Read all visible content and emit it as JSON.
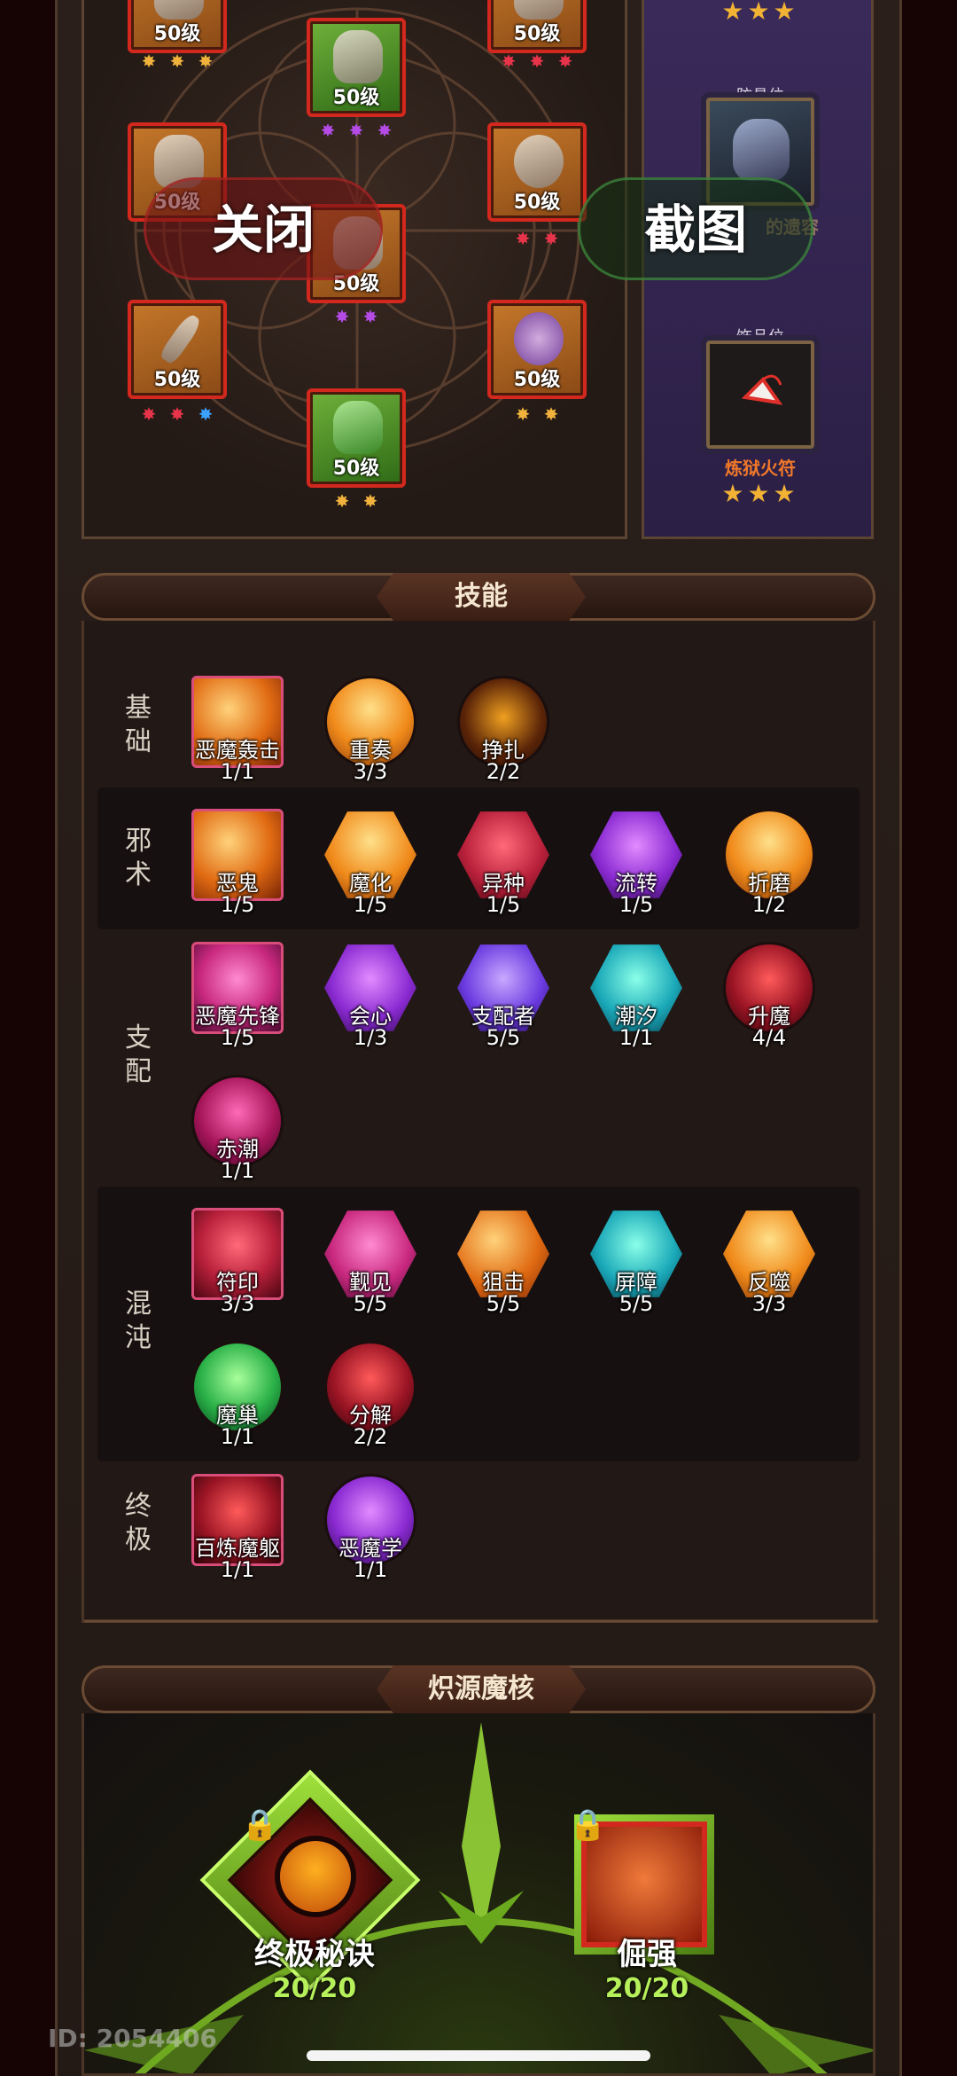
{
  "equipment": {
    "items": [
      {
        "level": "50级",
        "gems": [
          "gold",
          "gold",
          "gold"
        ]
      },
      {
        "level": "50级",
        "gems": [
          "red",
          "red",
          "red"
        ]
      },
      {
        "level": "50级",
        "gems": [
          "purple",
          "purple",
          "purple"
        ]
      },
      {
        "level": "50级",
        "gems": [
          "red",
          "red"
        ]
      },
      {
        "level": "50级",
        "gems": [
          "red",
          "red"
        ]
      },
      {
        "level": "50级",
        "gems": [
          "purple",
          "purple"
        ]
      },
      {
        "level": "50级",
        "gems": [
          "red",
          "red",
          "blue"
        ]
      },
      {
        "level": "50级",
        "gems": [
          "gold",
          "gold"
        ]
      },
      {
        "level": "50级",
        "gems": [
          "gold",
          "gold"
        ]
      }
    ],
    "slots": {
      "armor_label": "防具位",
      "armor_name": "的遗容",
      "accessory_label": "饰品位",
      "accessory_name": "炼狱火符"
    }
  },
  "overlay": {
    "close_label": "关闭",
    "screenshot_label": "截图"
  },
  "skills": {
    "title": "技能",
    "categories": [
      {
        "label": "基础",
        "skills": [
          {
            "name": "恶魔轰击",
            "count": "1/1",
            "shape": "sq",
            "color": "c-orange"
          },
          {
            "name": "重奏",
            "count": "3/3",
            "shape": "ci",
            "color": "c-orange2"
          },
          {
            "name": "挣扎",
            "count": "2/2",
            "shape": "ci",
            "color": "c-dark"
          }
        ]
      },
      {
        "label": "邪术",
        "skills": [
          {
            "name": "恶鬼",
            "count": "1/5",
            "shape": "sq",
            "color": "c-orange"
          },
          {
            "name": "魔化",
            "count": "1/5",
            "shape": "hex",
            "color": "c-orange2"
          },
          {
            "name": "异种",
            "count": "1/5",
            "shape": "hex",
            "color": "c-red"
          },
          {
            "name": "流转",
            "count": "1/5",
            "shape": "hex",
            "color": "c-purple"
          },
          {
            "name": "折磨",
            "count": "1/2",
            "shape": "ci",
            "color": "c-orange2"
          }
        ]
      },
      {
        "label": "支配",
        "skills": [
          {
            "name": "恶魔先锋",
            "count": "1/5",
            "shape": "sq",
            "color": "c-pink"
          },
          {
            "name": "会心",
            "count": "1/3",
            "shape": "hex",
            "color": "c-purple"
          },
          {
            "name": "支配者",
            "count": "5/5",
            "shape": "hex",
            "color": "c-violet"
          },
          {
            "name": "潮汐",
            "count": "1/1",
            "shape": "hex",
            "color": "c-teal"
          },
          {
            "name": "升魔",
            "count": "4/4",
            "shape": "ci",
            "color": "c-crimson"
          },
          {
            "name": "赤潮",
            "count": "1/1",
            "shape": "ci",
            "color": "c-magenta"
          }
        ]
      },
      {
        "label": "混沌",
        "skills": [
          {
            "name": "符印",
            "count": "3/3",
            "shape": "sq",
            "color": "c-red"
          },
          {
            "name": "觐见",
            "count": "5/5",
            "shape": "hex",
            "color": "c-pink"
          },
          {
            "name": "狙击",
            "count": "5/5",
            "shape": "hex",
            "color": "c-orange"
          },
          {
            "name": "屏障",
            "count": "5/5",
            "shape": "hex",
            "color": "c-teal"
          },
          {
            "name": "反噬",
            "count": "3/3",
            "shape": "hex",
            "color": "c-orange2"
          },
          {
            "name": "魔巢",
            "count": "1/1",
            "shape": "ci",
            "color": "c-green"
          },
          {
            "name": "分解",
            "count": "2/2",
            "shape": "ci",
            "color": "c-crimson"
          }
        ]
      },
      {
        "label": "终极",
        "skills": [
          {
            "name": "百炼魔躯",
            "count": "1/1",
            "shape": "sq",
            "color": "c-crimson"
          },
          {
            "name": "恶魔学",
            "count": "1/1",
            "shape": "ci",
            "color": "c-purple"
          }
        ]
      }
    ]
  },
  "core": {
    "title": "炽源魔核",
    "nodes": [
      {
        "name": "终极秘诀",
        "count": "20/20"
      },
      {
        "name": "倔强",
        "count": "20/20"
      }
    ]
  },
  "watermark": "ID: 2054406",
  "colors": {
    "accent_red": "#d2281e",
    "accent_green": "#b6f05a",
    "panel_purple": "#2b1f45"
  }
}
